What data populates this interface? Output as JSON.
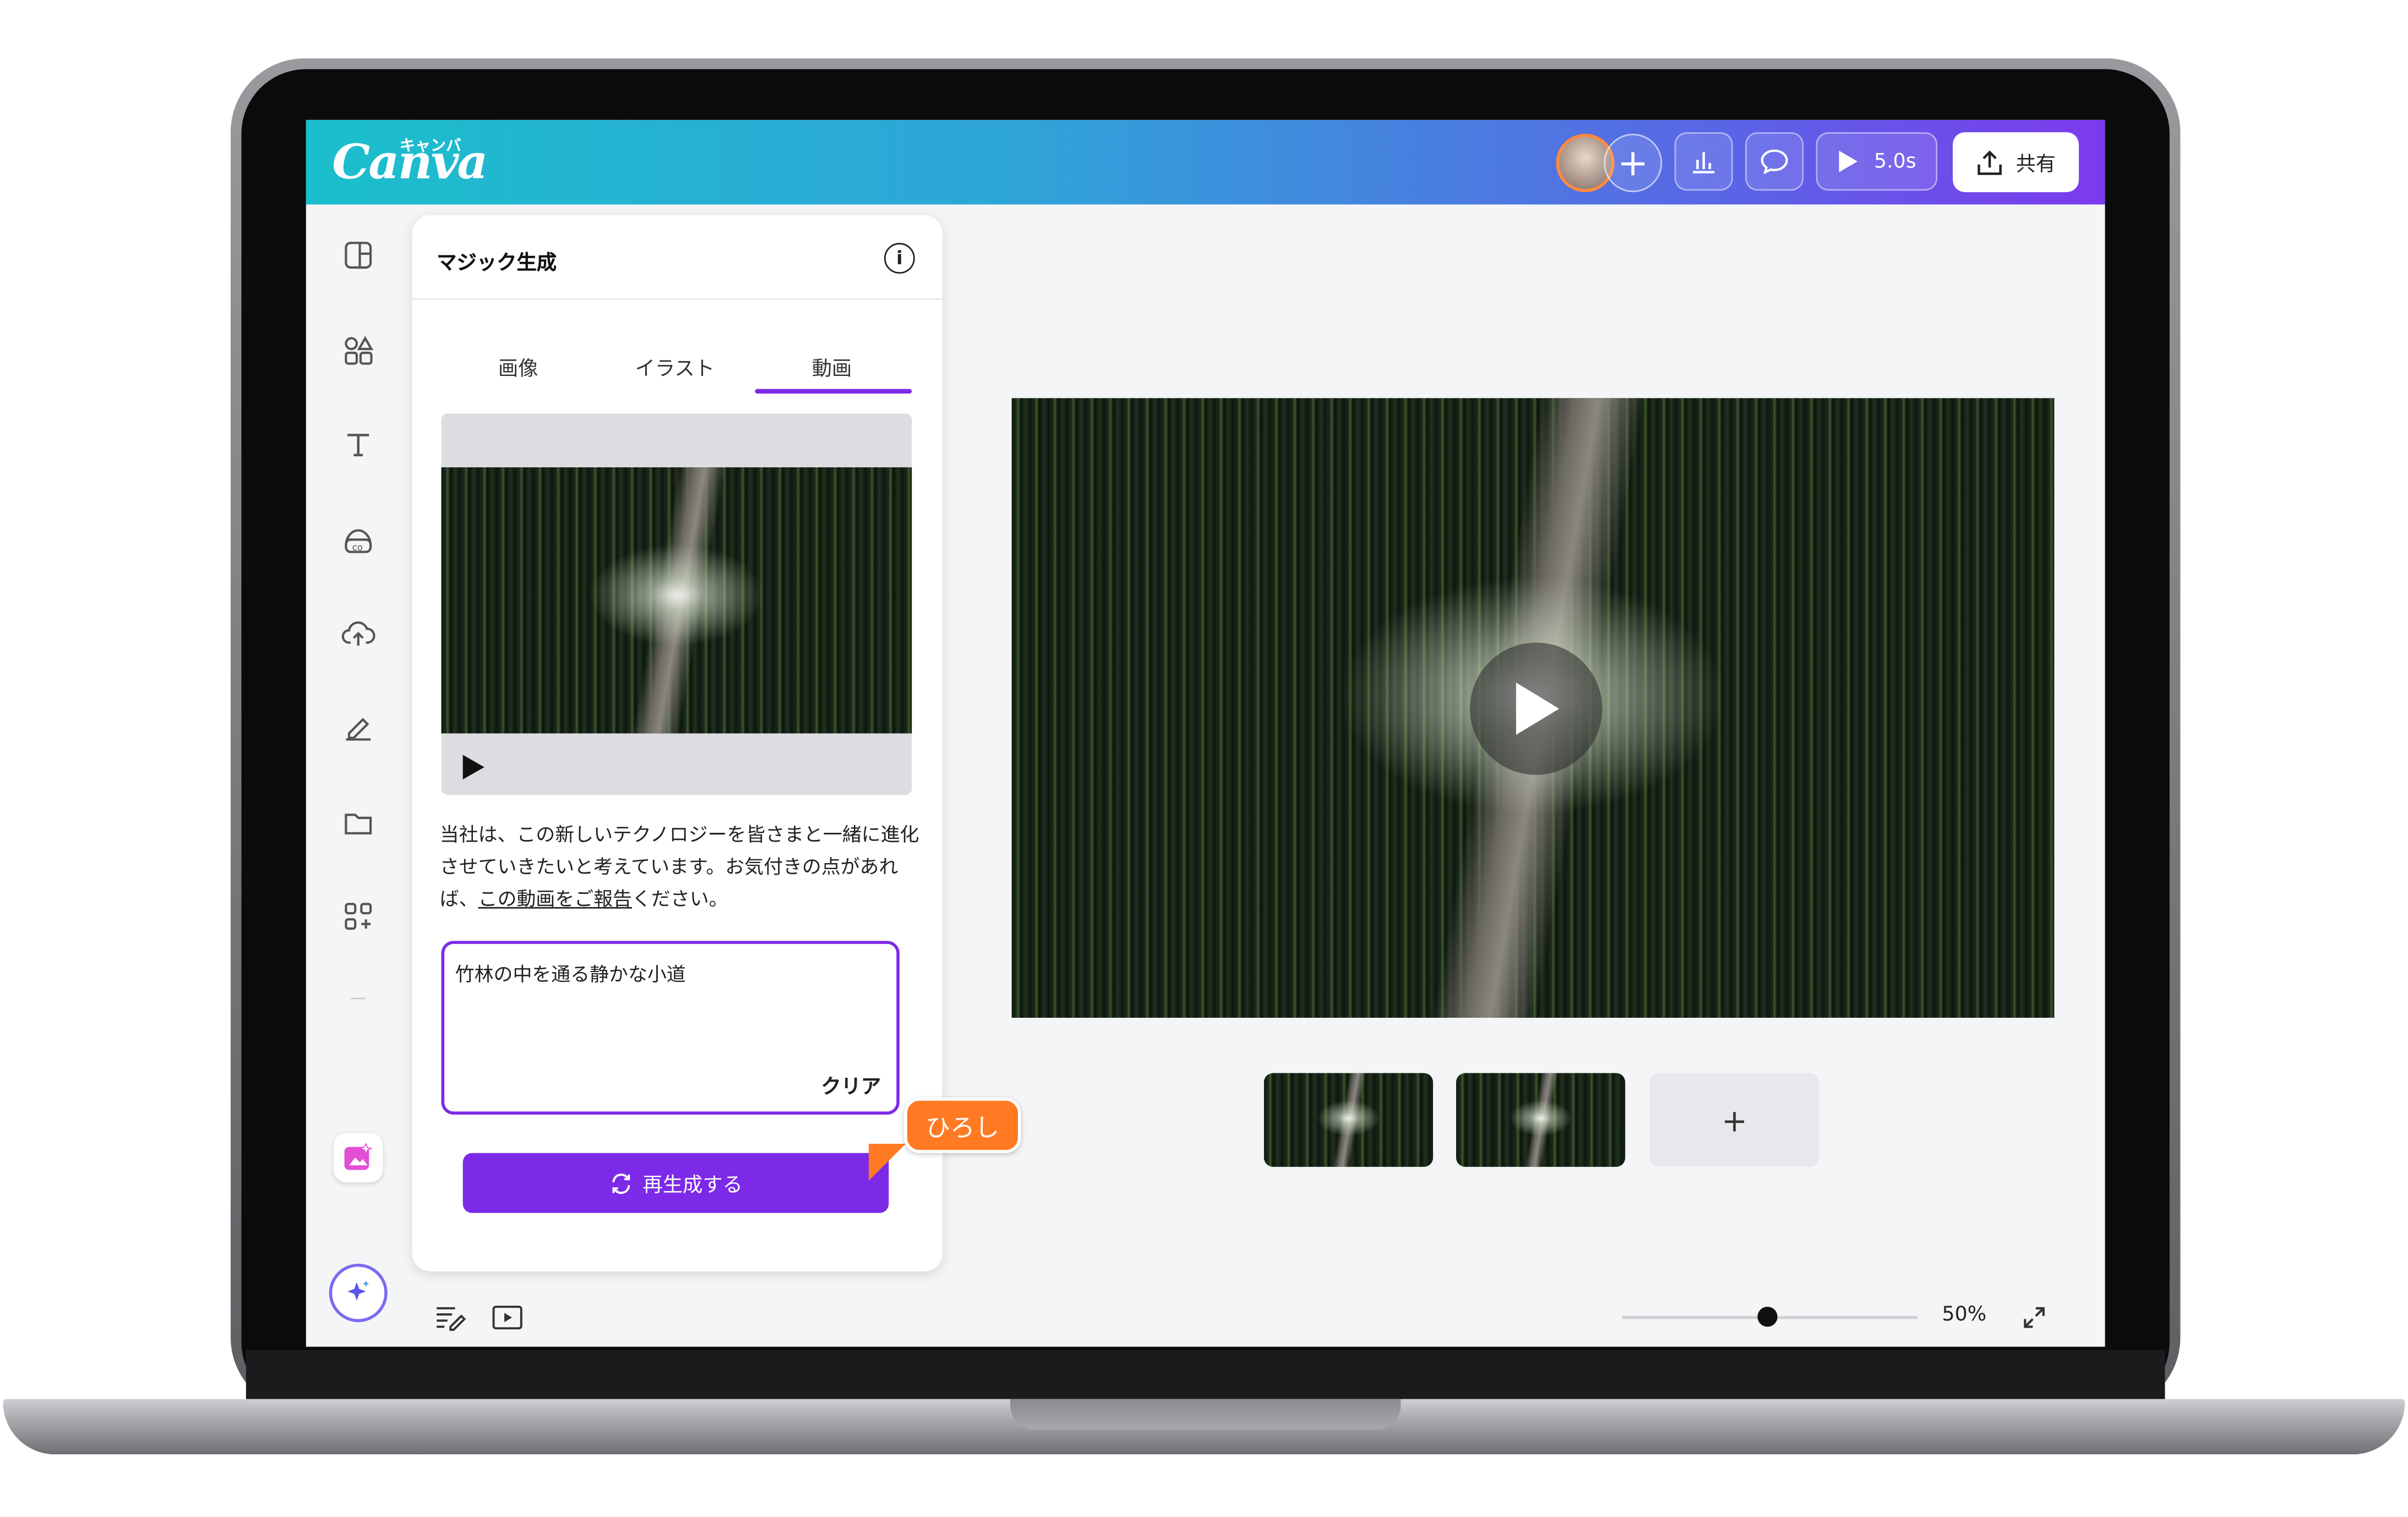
{
  "app": {
    "logo": "Canva",
    "logo_kana": "キャンバ",
    "brand_colors": {
      "primary": "#7d2ae8",
      "teal": "#1bbfcc",
      "cursor": "#ff7a22"
    }
  },
  "header": {
    "play_duration": "5.0s",
    "share_label": "共有",
    "icons": [
      "avatar",
      "add-collaborator-icon",
      "insights-icon",
      "comment-icon",
      "play-icon",
      "share-icon"
    ]
  },
  "sidebar": {
    "items": [
      "design-icon",
      "elements-icon",
      "text-icon",
      "brand-icon",
      "uploads-icon",
      "draw-icon",
      "projects-icon",
      "apps-icon",
      "magic-media-icon"
    ]
  },
  "panel": {
    "title": "マジック生成",
    "tabs": [
      {
        "label": "画像",
        "active": false
      },
      {
        "label": "イラスト",
        "active": false
      },
      {
        "label": "動画",
        "active": true
      }
    ],
    "notice_part1": "当社は、この新しいテクノロジーを皆さまと一緒に進化させていきたいと考えています。お気付きの点があれば、",
    "notice_link": "この動画をご報告",
    "notice_part2": "ください。",
    "prompt_value": "竹林の中を通る静かな小道",
    "clear_label": "クリア",
    "regenerate_label": "再生成する"
  },
  "collaborator": {
    "name": "ひろし"
  },
  "canvas": {
    "add_page_label": "+",
    "zoom_label": "50%",
    "zoom_fraction": 0.5
  }
}
